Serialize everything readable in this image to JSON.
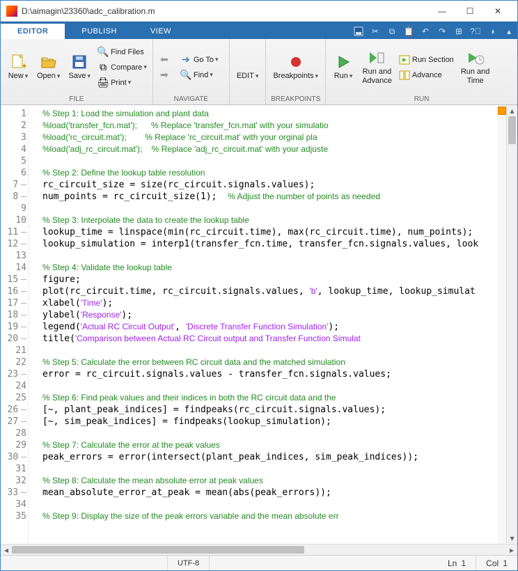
{
  "title": "D:\\aimagin\\23360\\adc_calibration.m",
  "tabs": {
    "editor": "EDITOR",
    "publish": "PUBLISH",
    "view": "VIEW"
  },
  "ribbon": {
    "file": {
      "new": "New",
      "open": "Open",
      "save": "Save",
      "find_files": "Find Files",
      "compare": "Compare",
      "print": "Print",
      "label": "FILE"
    },
    "nav": {
      "goto": "Go To",
      "find": "Find",
      "label": "NAVIGATE"
    },
    "edit": {
      "edit": "EDIT"
    },
    "bp": {
      "breakpoints": "Breakpoints",
      "label": "BREAKPOINTS"
    },
    "run": {
      "run": "Run",
      "run_adv": "Run and\nAdvance",
      "run_sec": "Run Section",
      "advance": "Advance",
      "run_time": "Run and\nTime",
      "label": "RUN"
    }
  },
  "status": {
    "encoding": "UTF-8",
    "ln": "Ln",
    "ln_v": "1",
    "col": "Col",
    "col_v": "1"
  },
  "code": [
    {
      "n": 1,
      "d": false,
      "h": "<span class=\"cm\">% Step 1: Load the simulation and plant data</span>"
    },
    {
      "n": 2,
      "d": false,
      "h": "<span class=\"cm\">%load('transfer_fcn.mat');      % Replace 'transfer_fcn.mat' with your simulatio</span>"
    },
    {
      "n": 3,
      "d": false,
      "h": "<span class=\"cm\">%load('rc_circuit.mat');        % Replace 'rc_circuit.mat' with your orginal pla</span>"
    },
    {
      "n": 4,
      "d": false,
      "h": "<span class=\"cm\">%load('adj_rc_circuit.mat');    % Replace 'adj_rc_circuit.mat' with your adjuste</span>"
    },
    {
      "n": 5,
      "d": false,
      "h": ""
    },
    {
      "n": 6,
      "d": false,
      "h": "<span class=\"cm\">% Step 2: Define the lookup table resolution</span>"
    },
    {
      "n": 7,
      "d": true,
      "h": "rc_circuit_size = size(rc_circuit.signals.values);"
    },
    {
      "n": 8,
      "d": true,
      "h": "num_points = rc_circuit_size(1);  <span class=\"cm\">% Adjust the number of points as needed</span>"
    },
    {
      "n": 9,
      "d": false,
      "h": ""
    },
    {
      "n": 10,
      "d": false,
      "h": "<span class=\"cm\">% Step 3: Interpolate the data to create the lookup table</span>"
    },
    {
      "n": 11,
      "d": true,
      "h": "lookup_time = linspace(min(rc_circuit.time), max(rc_circuit.time), num_points);"
    },
    {
      "n": 12,
      "d": true,
      "h": "lookup_simulation = interp1(transfer_fcn.time, transfer_fcn.signals.values, look"
    },
    {
      "n": 13,
      "d": false,
      "h": ""
    },
    {
      "n": 14,
      "d": false,
      "h": "<span class=\"cm\">% Step 4: Validate the lookup table</span>"
    },
    {
      "n": 15,
      "d": true,
      "h": "figure;"
    },
    {
      "n": 16,
      "d": true,
      "h": "plot(rc_circuit.time, rc_circuit.signals.values, <span class=\"st\">'b'</span>, lookup_time, lookup_simulat"
    },
    {
      "n": 17,
      "d": true,
      "h": "xlabel(<span class=\"st\">'Time'</span>);"
    },
    {
      "n": 18,
      "d": true,
      "h": "ylabel(<span class=\"st\">'Response'</span>);"
    },
    {
      "n": 19,
      "d": true,
      "h": "legend(<span class=\"st\">'Actual RC Circuit Output'</span>, <span class=\"st\">'Discrete Transfer Function Simulation'</span>);"
    },
    {
      "n": 20,
      "d": true,
      "h": "title(<span class=\"st\">'Comparison between Actual RC Circuit output and Transfer Function Simulat</span>"
    },
    {
      "n": 21,
      "d": false,
      "h": ""
    },
    {
      "n": 22,
      "d": false,
      "h": "<span class=\"cm\">% Step 5: Calculate the error between RC circuit data and the matched simulation</span>"
    },
    {
      "n": 23,
      "d": true,
      "h": "error = rc_circuit.signals.values - transfer_fcn.signals.values;"
    },
    {
      "n": 24,
      "d": false,
      "h": ""
    },
    {
      "n": 25,
      "d": false,
      "h": "<span class=\"cm\">% Step 6: Find peak values and their indices in both the RC circuit data and the</span>"
    },
    {
      "n": 26,
      "d": true,
      "h": "[~, plant_peak_indices] = findpeaks(rc_circuit.signals.values);"
    },
    {
      "n": 27,
      "d": true,
      "h": "[~, sim_peak_indices] = findpeaks(lookup_simulation);"
    },
    {
      "n": 28,
      "d": false,
      "h": ""
    },
    {
      "n": 29,
      "d": false,
      "h": "<span class=\"cm\">% Step 7: Calculate the error at the peak values</span>"
    },
    {
      "n": 30,
      "d": true,
      "h": "peak_errors = error(intersect(plant_peak_indices, sim_peak_indices));"
    },
    {
      "n": 31,
      "d": false,
      "h": ""
    },
    {
      "n": 32,
      "d": false,
      "h": "<span class=\"cm\">% Step 8: Calculate the mean absolute error at peak values</span>"
    },
    {
      "n": 33,
      "d": true,
      "h": "mean_absolute_error_at_peak = mean(abs(peak_errors));"
    },
    {
      "n": 34,
      "d": false,
      "h": ""
    },
    {
      "n": 35,
      "d": false,
      "h": "<span class=\"cm\">% Step 9: Display the size of the peak errors variable and the mean absolute err</span>"
    }
  ]
}
